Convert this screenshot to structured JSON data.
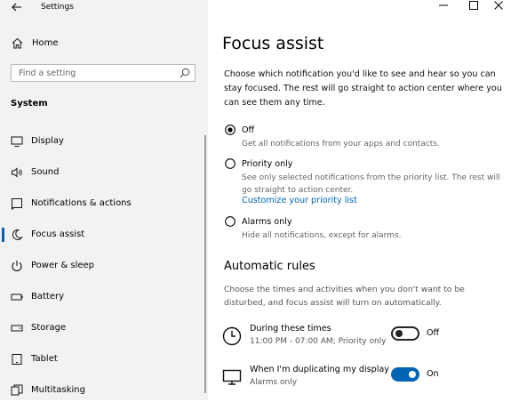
{
  "window": {
    "app_title": "Settings",
    "controls": [
      "minimize",
      "maximize",
      "close"
    ]
  },
  "sidebar": {
    "home_label": "Home",
    "search_placeholder": "Find a setting",
    "section_title": "System",
    "items": [
      {
        "label": "Display",
        "icon": "monitor-icon",
        "selected": false
      },
      {
        "label": "Sound",
        "icon": "speaker-icon",
        "selected": false
      },
      {
        "label": "Notifications & actions",
        "icon": "notification-icon",
        "selected": false
      },
      {
        "label": "Focus assist",
        "icon": "moon-icon",
        "selected": true
      },
      {
        "label": "Power & sleep",
        "icon": "power-icon",
        "selected": false
      },
      {
        "label": "Battery",
        "icon": "battery-icon",
        "selected": false
      },
      {
        "label": "Storage",
        "icon": "storage-icon",
        "selected": false
      },
      {
        "label": "Tablet",
        "icon": "tablet-icon",
        "selected": false
      },
      {
        "label": "Multitasking",
        "icon": "multitasking-icon",
        "selected": false
      }
    ]
  },
  "main": {
    "title": "Focus assist",
    "description": "Choose which notification you'd like to see and hear so you can stay focused. The rest will go straight to action center where you can see them any time.",
    "options": [
      {
        "label": "Off",
        "description": "Get all notifications from your apps and contacts.",
        "checked": true
      },
      {
        "label": "Priority only",
        "description": "See only selected notifications from the priority list. The rest will go straight to action center.",
        "link": "Customize your priority list",
        "checked": false
      },
      {
        "label": "Alarms only",
        "description": "Hide all notifications, except for alarms.",
        "checked": false
      }
    ],
    "automatic_rules": {
      "title": "Automatic rules",
      "description": "Choose the times and activities when you don't want to be disturbed, and focus assist will turn on automatically.",
      "rules": [
        {
          "title": "During these times",
          "subtitle": "11:00 PM - 07:00 AM; Priority only",
          "state": "Off",
          "icon": "clock-icon"
        },
        {
          "title": "When I'm duplicating my display",
          "subtitle": "Alarms only",
          "state": "On",
          "icon": "display-icon"
        }
      ]
    }
  },
  "colors": {
    "accent": "#0064b4",
    "sidebar_bg": "#f2f2f2"
  }
}
